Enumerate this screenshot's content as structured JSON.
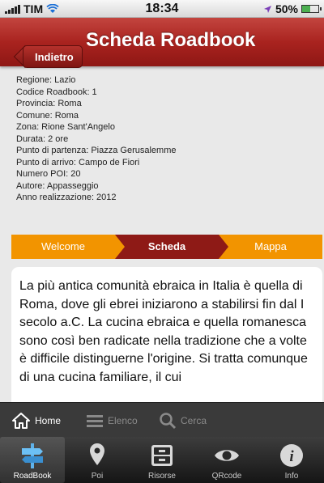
{
  "status_bar": {
    "carrier": "TIM",
    "time": "18:34",
    "battery": "50%",
    "battery_level": 0.5
  },
  "navbar": {
    "back_label": "Indietro",
    "title": "Scheda Roadbook"
  },
  "info": [
    "Regione: Lazio",
    "Codice Roadbook: 1",
    "Provincia: Roma",
    "Comune: Roma",
    "Zona: Rione Sant'Angelo",
    "Durata: 2 ore",
    "Punto di partenza: Piazza Gerusalemme",
    "Punto di arrivo: Campo de Fiori",
    "Numero POI: 20",
    "Autore: Appasseggio",
    "Anno realizzazione: 2012"
  ],
  "segments": {
    "welcome": "Welcome",
    "scheda": "Scheda",
    "mappa": "Mappa",
    "selected": "Scheda"
  },
  "content": {
    "text": "La più antica comunità ebraica in Italia è quella di Roma, dove gli ebrei iniziarono a stabilirsi fin dal I secolo a.C. La cucina ebraica e quella romanesca sono così ben radicate nella tradizione che a volte è difficile distinguerne l'origine. Si tratta comunque di una cucina familiare, il cui"
  },
  "toolbar": {
    "home": "Home",
    "elenco": "Elenco",
    "cerca": "Cerca"
  },
  "tabs": [
    {
      "label": "RoadBook",
      "icon": "signpost-icon",
      "active": true
    },
    {
      "label": "Poi",
      "icon": "map-pin-icon",
      "active": false
    },
    {
      "label": "Risorse",
      "icon": "cabinet-icon",
      "active": false
    },
    {
      "label": "QRcode",
      "icon": "eye-icon",
      "active": false
    },
    {
      "label": "Info",
      "icon": "info-icon",
      "active": false
    }
  ],
  "colors": {
    "navbar": "#a9231f",
    "segment": "#f29400",
    "segment_selected": "#8e1a16"
  }
}
